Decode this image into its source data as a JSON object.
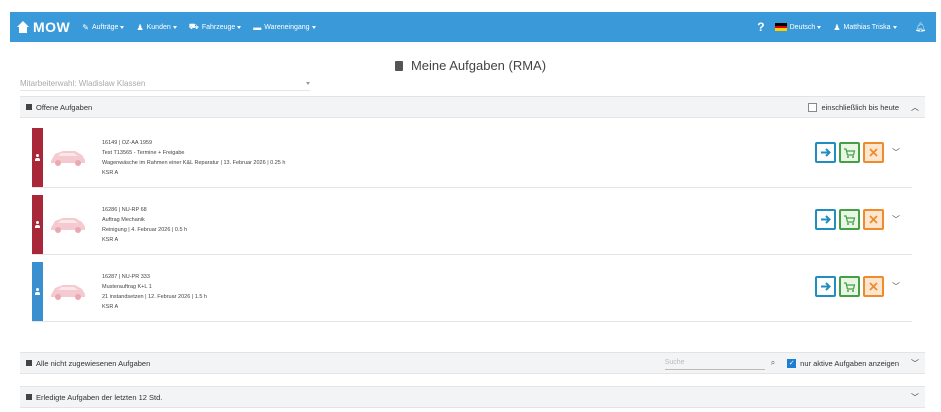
{
  "navbar": {
    "brand": "MOW",
    "menus": [
      {
        "label": "Aufträge",
        "icon": "wrench-icon",
        "glyph": "✎"
      },
      {
        "label": "Kunden",
        "icon": "user-icon",
        "glyph": "♟"
      },
      {
        "label": "Fahrzeuge",
        "icon": "car-icon",
        "glyph": "⛟"
      },
      {
        "label": "Wareneingang",
        "icon": "truck-icon",
        "glyph": "▬"
      }
    ],
    "help": "?",
    "language": "Deutsch",
    "user": "Matthias Triska",
    "colors": {
      "bar": "#3a9ad9"
    }
  },
  "page": {
    "title": "Meine Aufgaben (RMA)",
    "employee_select": "Mitarbeiterwahl: Wladislaw Klassen"
  },
  "open_tasks": {
    "title": "Offene Aufgaben",
    "filter_label": "einschließlich bis heute",
    "filter_checked": false,
    "tasks": [
      {
        "color": "#a8283a",
        "line1": "16149 | OZ-AA 1959",
        "line2": "Test T13565 - Termine + Freigabe",
        "line3": "Wagenwäsche im Rahmen einer K&L Reparatur | 13. Februar 2026 | 0.25 h",
        "line4": "KSR A"
      },
      {
        "color": "#a8283a",
        "line1": "16286 | NU-RP 68",
        "line2": "Auftrag Mechanik",
        "line3": "Reinigung | 4. Februar 2026 | 0.5 h",
        "line4": "KSR A"
      },
      {
        "color": "#3a8fd0",
        "line1": "16287 | NU-PR 333",
        "line2": "Musterauftrag K+L 1",
        "line3": "21 instandsetzen | 12. Februar 2026 | 1.5 h",
        "line4": "KSR A"
      }
    ]
  },
  "unassigned": {
    "title": "Alle nicht zugewiesenen Aufgaben",
    "search_placeholder": "Suche",
    "active_label": "nur aktive Aufgaben anzeigen",
    "active_checked": true
  },
  "completed": {
    "title": "Erledigte Aufgaben der letzten 12 Std."
  }
}
